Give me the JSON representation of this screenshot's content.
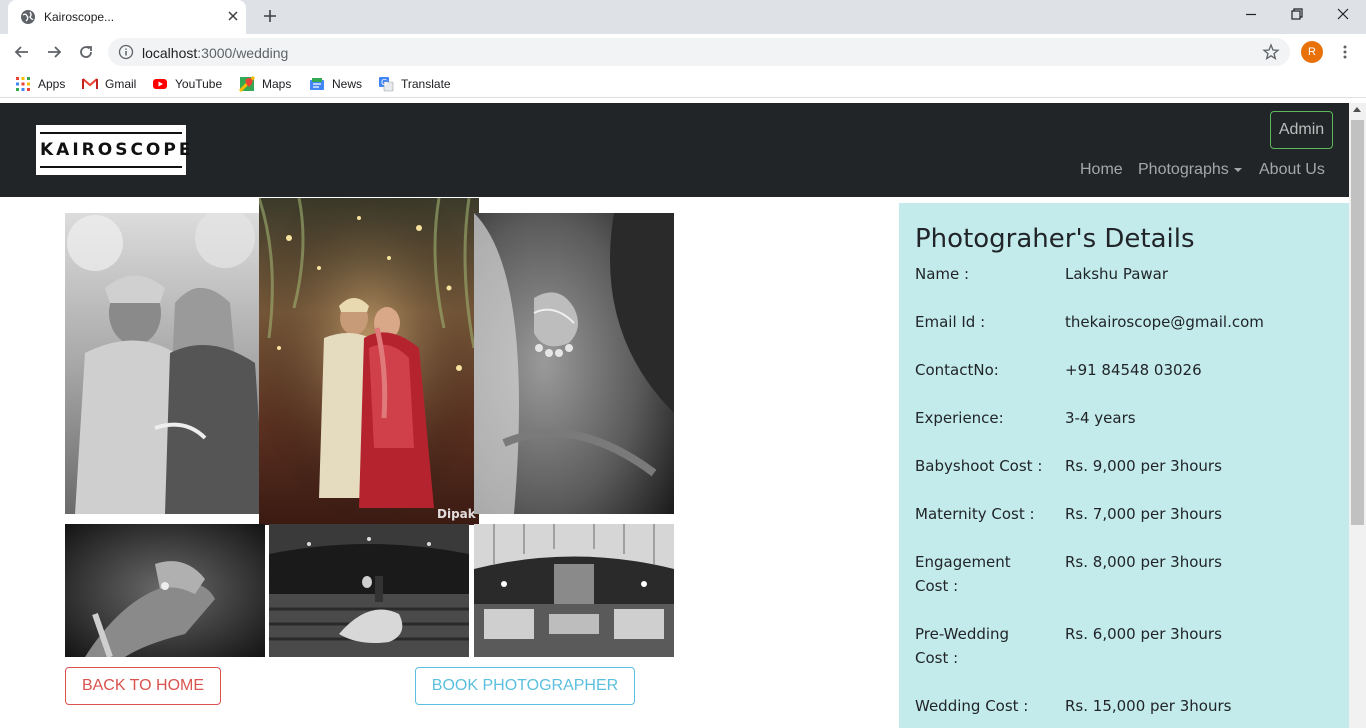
{
  "browser": {
    "tab_title": "Kairoscope...",
    "url_host": "localhost",
    "url_path": ":3000/wedding",
    "profile_initial": "R",
    "bookmarks": [
      "Apps",
      "Gmail",
      "YouTube",
      "Maps",
      "News",
      "Translate"
    ]
  },
  "site": {
    "logo_text": "KAIROSCOPE",
    "admin_label": "Admin",
    "nav": {
      "home": "Home",
      "photographs": "Photographs",
      "about": "About Us"
    }
  },
  "gallery": {
    "watermark_featured": "Dipak",
    "back_label": "BACK TO HOME",
    "book_label": "BOOK PHOTOGRAPHER"
  },
  "details": {
    "title": "Photograher's Details",
    "rows": [
      {
        "label": "Name :",
        "value": "Lakshu Pawar"
      },
      {
        "label": "Email Id :",
        "value": "thekairoscope@gmail.com"
      },
      {
        "label": "ContactNo:",
        "value": "+91 84548 03026"
      },
      {
        "label": "Experience:",
        "value": "3-4 years"
      },
      {
        "label": "Babyshoot Cost :",
        "value": "Rs. 9,000 per 3hours"
      },
      {
        "label": "Maternity Cost :",
        "value": "Rs. 7,000 per 3hours"
      },
      {
        "label": "Engagement Cost :",
        "value": "Rs. 8,000 per 3hours"
      },
      {
        "label": "Pre-Wedding Cost :",
        "value": "Rs. 6,000 per 3hours"
      },
      {
        "label": "Wedding Cost :",
        "value": "Rs. 15,000 per 3hours"
      }
    ]
  },
  "colors": {
    "navbar_bg": "#222527",
    "details_bg": "#c4ebeb",
    "back_button": "#d9534f",
    "book_button": "#5bc0de",
    "admin_border": "#5cb85c"
  }
}
